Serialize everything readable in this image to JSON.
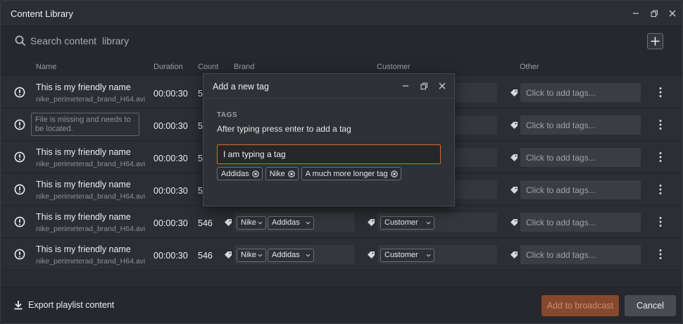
{
  "window": {
    "title": "Content Library"
  },
  "search": {
    "placeholder": "Search content  library"
  },
  "columns": {
    "name": "Name",
    "duration": "Duration",
    "count": "Count",
    "brand": "Brand",
    "customer": "Customer",
    "other": "Other"
  },
  "rows": [
    {
      "name": "This is my friendly name",
      "file": "nike_perimeterad_brand_H64.avi",
      "duration": "00:00:30",
      "count": "5",
      "brand_tags": [],
      "customer_tags": [],
      "other_placeholder": "Click to add tags..."
    },
    {
      "name": "",
      "file": "",
      "missing": "File is missing and  needs to be located.",
      "duration": "00:00:30",
      "count": "5",
      "brand_tags": [],
      "customer_tags": [],
      "other_placeholder": "Click to add tags..."
    },
    {
      "name": "This is my friendly name",
      "file": "nike_perimeterad_brand_H64.avi",
      "duration": "00:00:30",
      "count": "5",
      "brand_tags": [],
      "customer_tags": [],
      "other_placeholder": "Click to add tags..."
    },
    {
      "name": "This is my friendly name",
      "file": "nike_perimeterad_brand_H64.avi",
      "duration": "00:00:30",
      "count": "5",
      "brand_tags": [],
      "customer_tags": [],
      "other_placeholder": "Click to add tags..."
    },
    {
      "name": "This is my friendly name",
      "file": "nike_perimeterad_brand_H64.avi",
      "duration": "00:00:30",
      "count": "546",
      "brand_tags": [
        "Nike",
        "Addidas"
      ],
      "customer_tags": [
        "Customer"
      ],
      "other_placeholder": "Click to add tags..."
    },
    {
      "name": "This is my friendly name",
      "file": "nike_perimeterad_brand_H64.avi",
      "duration": "00:00:30",
      "count": "546",
      "brand_tags": [
        "Nike",
        "Addidas"
      ],
      "customer_tags": [
        "Customer"
      ],
      "other_placeholder": "Click to add tags..."
    }
  ],
  "modal": {
    "title": "Add a new tag",
    "section_label": "TAGS",
    "hint": "After typing press enter to add a tag",
    "input_value": "I am typing a tag",
    "tags": [
      "Addidas",
      "Nike",
      "A much more longer tag"
    ]
  },
  "footer": {
    "export_label": "Export playlist content",
    "broadcast_label": "Add to broadcast",
    "cancel_label": "Cancel"
  },
  "colors": {
    "accent": "#d9682e",
    "broadcast_disabled": "#87492c",
    "background": "#2a2c31"
  },
  "icons": {
    "search": "search-icon",
    "add": "plus-icon",
    "alert": "alert-circle-icon",
    "tag": "tag-icon",
    "more": "kebab-icon",
    "export": "download-icon"
  }
}
